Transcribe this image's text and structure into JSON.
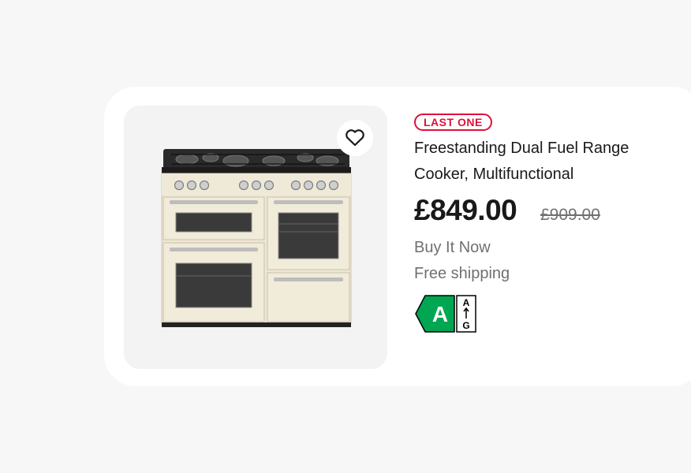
{
  "listing": {
    "badge": "LAST ONE",
    "title_line1": "Freestanding Dual Fuel Range",
    "title_line2": "Cooker, Multifunctional",
    "price": "£849.00",
    "original_price": "£909.00",
    "format": "Buy It Now",
    "shipping": "Free shipping",
    "energy_rating": {
      "class": "A",
      "scale_top": "A",
      "scale_bottom": "G"
    }
  },
  "colors": {
    "badge": "#e0103a",
    "energy_green": "#00a651",
    "card_bg": "#ffffff",
    "page_bg": "#f7f7f7"
  },
  "icons": {
    "watch": "heart-outline-icon",
    "product": "range-cooker-image"
  }
}
